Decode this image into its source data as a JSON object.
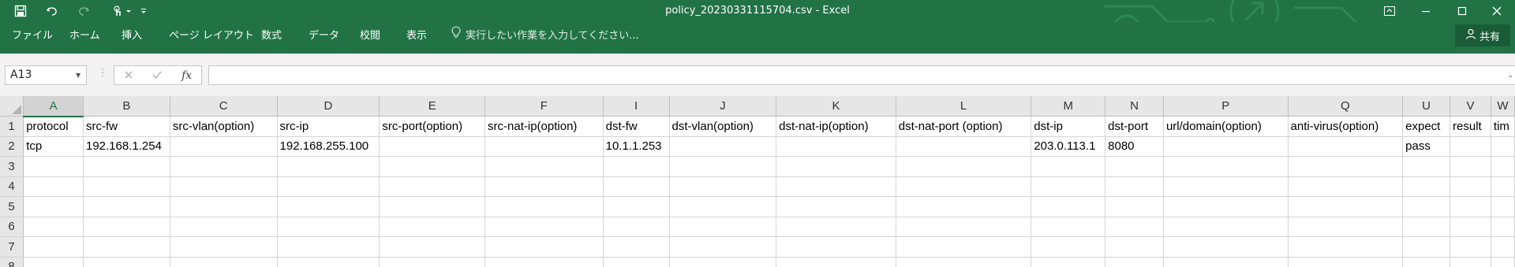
{
  "titlebar": {
    "doc_title": "policy_20230331115704.csv  -  Excel"
  },
  "ribbon": {
    "tabs": [
      "ファイル",
      "ホーム",
      "挿入",
      "ページ レイアウト",
      "数式",
      "データ",
      "校閲",
      "表示"
    ],
    "tell_me": "実行したい作業を入力してください...",
    "share": "共有"
  },
  "formula_bar": {
    "name_box": "A13",
    "fx": "fx",
    "content": ""
  },
  "sheet": {
    "columns": [
      {
        "letter": "A",
        "w": 76
      },
      {
        "letter": "B",
        "w": 110
      },
      {
        "letter": "C",
        "w": 136
      },
      {
        "letter": "D",
        "w": 130
      },
      {
        "letter": "E",
        "w": 134
      },
      {
        "letter": "F",
        "w": 150
      },
      {
        "letter": "I",
        "w": 84
      },
      {
        "letter": "J",
        "w": 136
      },
      {
        "letter": "K",
        "w": 152
      },
      {
        "letter": "L",
        "w": 172
      },
      {
        "letter": "M",
        "w": 94
      },
      {
        "letter": "N",
        "w": 74
      },
      {
        "letter": "P",
        "w": 158
      },
      {
        "letter": "Q",
        "w": 146
      },
      {
        "letter": "U",
        "w": 60
      },
      {
        "letter": "V",
        "w": 52
      },
      {
        "letter": "W",
        "w": 30
      }
    ],
    "rows": [
      {
        "num": "1",
        "cells": [
          "protocol",
          "src-fw",
          "src-vlan(option)",
          "src-ip",
          "src-port(option)",
          "src-nat-ip(option)",
          "dst-fw",
          "dst-vlan(option)",
          "dst-nat-ip(option)",
          "dst-nat-port (option)",
          "dst-ip",
          "dst-port",
          "url/domain(option)",
          "anti-virus(option)",
          "expect",
          "result",
          "tim"
        ]
      },
      {
        "num": "2",
        "cells": [
          "tcp",
          "192.168.1.254",
          "",
          "192.168.255.100",
          "",
          "",
          "10.1.1.253",
          "",
          "",
          "",
          "203.0.113.1",
          "8080",
          "",
          "",
          "pass",
          "",
          ""
        ]
      },
      {
        "num": "3",
        "cells": [
          "",
          "",
          "",
          "",
          "",
          "",
          "",
          "",
          "",
          "",
          "",
          "",
          "",
          "",
          "",
          "",
          ""
        ]
      },
      {
        "num": "4",
        "cells": [
          "",
          "",
          "",
          "",
          "",
          "",
          "",
          "",
          "",
          "",
          "",
          "",
          "",
          "",
          "",
          "",
          ""
        ]
      },
      {
        "num": "5",
        "cells": [
          "",
          "",
          "",
          "",
          "",
          "",
          "",
          "",
          "",
          "",
          "",
          "",
          "",
          "",
          "",
          "",
          ""
        ]
      },
      {
        "num": "6",
        "cells": [
          "",
          "",
          "",
          "",
          "",
          "",
          "",
          "",
          "",
          "",
          "",
          "",
          "",
          "",
          "",
          "",
          ""
        ]
      },
      {
        "num": "7",
        "cells": [
          "",
          "",
          "",
          "",
          "",
          "",
          "",
          "",
          "",
          "",
          "",
          "",
          "",
          "",
          "",
          "",
          ""
        ]
      },
      {
        "num": "8",
        "cells": [
          "",
          "",
          "",
          "",
          "",
          "",
          "",
          "",
          "",
          "",
          "",
          "",
          "",
          "",
          "",
          "",
          ""
        ]
      }
    ],
    "numeric_cells": [
      "2-11"
    ]
  },
  "icons": {
    "save": "save-icon",
    "undo": "undo-icon",
    "redo": "redo-icon",
    "touch": "touch-mode-icon",
    "customize": "customize-qat-icon",
    "display": "ribbon-display-options-icon",
    "minimize": "minimize-icon",
    "maximize": "maximize-icon",
    "close": "close-icon",
    "lightbulb": "lightbulb-icon",
    "person": "person-icon"
  },
  "colors": {
    "accent": "#217346",
    "share_bg": "#1a5c38",
    "grid_line": "#d4d4d4",
    "header_bg": "#e6e6e6"
  }
}
